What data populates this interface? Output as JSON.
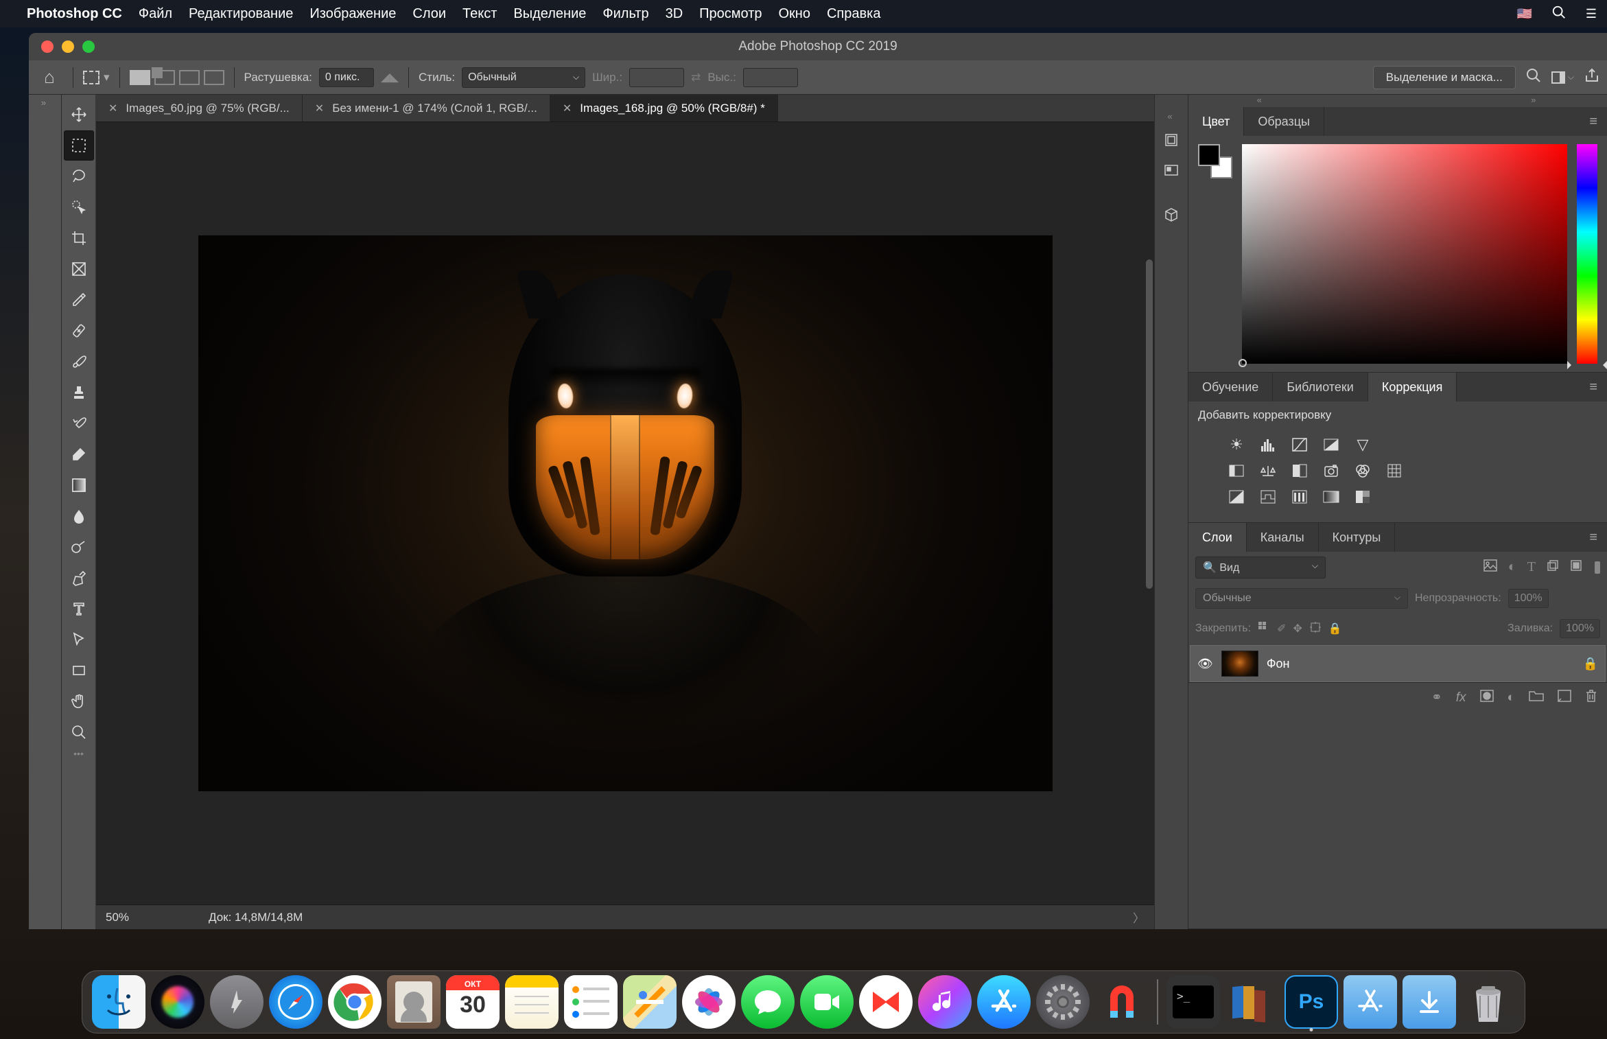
{
  "menubar": {
    "app": "Photoshop CC",
    "items": [
      "Файл",
      "Редактирование",
      "Изображение",
      "Слои",
      "Текст",
      "Выделение",
      "Фильтр",
      "3D",
      "Просмотр",
      "Окно",
      "Справка"
    ]
  },
  "window": {
    "title": "Adobe Photoshop CC 2019"
  },
  "optionsbar": {
    "feather_label": "Растушевка:",
    "feather_value": "0 пикс.",
    "style_label": "Стиль:",
    "style_value": "Обычный",
    "width_label": "Шир.:",
    "height_label": "Выс.:",
    "mask_btn": "Выделение и маска..."
  },
  "tabs": [
    {
      "label": "Images_60.jpg @ 75% (RGB/..."
    },
    {
      "label": "Без имени-1 @ 174% (Слой 1, RGB/..."
    },
    {
      "label": "Images_168.jpg @ 50% (RGB/8#) *",
      "active": true
    }
  ],
  "statusbar": {
    "zoom": "50%",
    "doc": "Док: 14,8M/14,8M"
  },
  "color_panel": {
    "tabs": [
      "Цвет",
      "Образцы"
    ]
  },
  "adj_panel": {
    "tabs": [
      "Обучение",
      "Библиотеки",
      "Коррекция"
    ],
    "label": "Добавить корректировку"
  },
  "layers_panel": {
    "tabs": [
      "Слои",
      "Каналы",
      "Контуры"
    ],
    "filter_type": "Вид",
    "blend": "Обычные",
    "opacity_label": "Непрозрачность:",
    "opacity": "100%",
    "lock_label": "Закрепить:",
    "fill_label": "Заливка:",
    "fill": "100%",
    "layer_name": "Фон"
  },
  "dock": {
    "cal_month": "ОКТ",
    "cal_day": "30"
  }
}
